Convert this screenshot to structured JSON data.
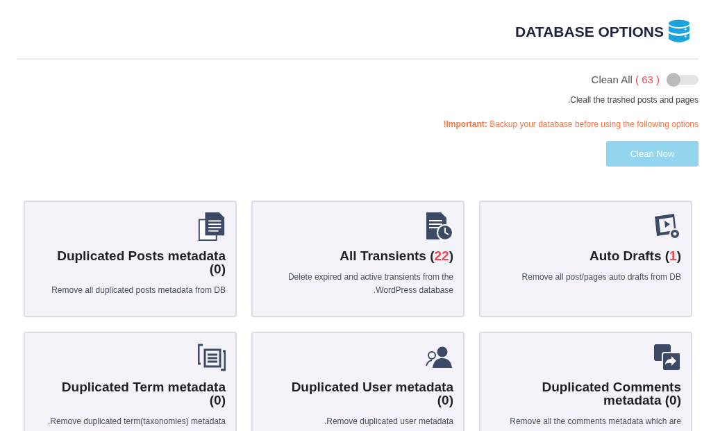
{
  "header": {
    "title": "DATABASE OPTIONS"
  },
  "clean_all": {
    "label": "Clean All",
    "count": "( 63 )",
    "on": false
  },
  "note": ".Cleall the trashed posts and pages",
  "warning": "**!Important:** Backup your database before using the following options",
  "clean_button": {
    "label": "Clean Now",
    "disabled": true
  },
  "cards": [
    {
      "title": "Duplicated Posts metadata (",
      "count": "0",
      "count_alert": false,
      "title_end": ")",
      "description": "Remove all duplicated posts metadata from DB"
    },
    {
      "title": "All Transients (",
      "count": "22",
      "count_alert": true,
      "title_end": ")",
      "description": "Delete expired and active transients from the .WordPress database"
    },
    {
      "title": "Auto Drafts (",
      "count": "1",
      "count_alert": true,
      "title_end": ")",
      "description": "Remove all post/pages auto drafts from DB"
    },
    {
      "title": "Duplicated Term metadata (",
      "count": "0",
      "count_alert": false,
      "title_end": ")",
      "description": ".Remove duplicated term(taxonomies) metadata"
    },
    {
      "title": "Duplicated User metadata (",
      "count": "0",
      "count_alert": false,
      "title_end": ")",
      "description": ".Remove duplicated user metadata"
    },
    {
      "title": "Duplicated Comments metadata (",
      "count": "0",
      "count_alert": false,
      "title_end": ")",
      "description": "Remove all the comments metadata which are"
    }
  ]
}
